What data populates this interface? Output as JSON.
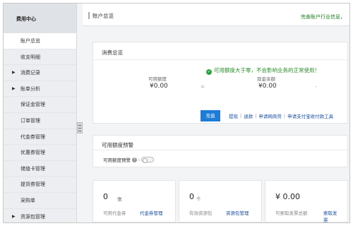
{
  "sidebar": {
    "header": "费用中心",
    "items": [
      {
        "label": "账户总览",
        "active": true,
        "expandable": false
      },
      {
        "label": "收支明细",
        "active": false,
        "expandable": false
      },
      {
        "label": "消费记录",
        "active": false,
        "expandable": true
      },
      {
        "label": "账单分析",
        "active": false,
        "expandable": true
      },
      {
        "label": "保证金管理",
        "active": false,
        "expandable": false
      },
      {
        "label": "订单管理",
        "active": false,
        "expandable": false
      },
      {
        "label": "代金券管理",
        "active": false,
        "expandable": false
      },
      {
        "label": "优惠券管理",
        "active": false,
        "expandable": false
      },
      {
        "label": "储值卡管理",
        "active": false,
        "expandable": false
      },
      {
        "label": "提货券管理",
        "active": false,
        "expandable": false
      },
      {
        "label": "采购单",
        "active": false,
        "expandable": false
      },
      {
        "label": "资源包管理",
        "active": false,
        "expandable": true
      }
    ]
  },
  "topbar": {
    "title": "账户总览",
    "notice": "完善账户行业信息，"
  },
  "consumption": {
    "title": "消费总览",
    "status_text": "可用额度大于零，不会影响业务的正常使用！",
    "available_label": "可用额度",
    "available_value": "¥0.00",
    "equals": "=",
    "cash_label": "现金余额",
    "cash_value": "¥0.00",
    "minus": "-",
    "recharge_button": "充值",
    "actions": [
      "提现",
      "退款",
      "申请网商贷",
      "申请支付宝收付款工具"
    ]
  },
  "quota_alert": {
    "title": "可用额度预警",
    "label": "可用额度预警"
  },
  "stats": [
    {
      "value": "0",
      "unit": "张",
      "label": "可用代金券",
      "link": "代金券管理",
      "link2": ""
    },
    {
      "value": "0",
      "unit": "个",
      "label": "有效资源包",
      "link": "资源包管理",
      "link2": ""
    },
    {
      "value": "¥ 0.00",
      "unit": "",
      "label": "可索取发票总额",
      "link": "索取发",
      "link2": "票"
    }
  ],
  "colors": {
    "primary": "#1e7bd6",
    "success": "#2ea043",
    "link": "#1b4f9b"
  },
  "icons": {
    "status": "check-circle-icon",
    "help": "help-icon",
    "expand": "caret-right-icon"
  }
}
